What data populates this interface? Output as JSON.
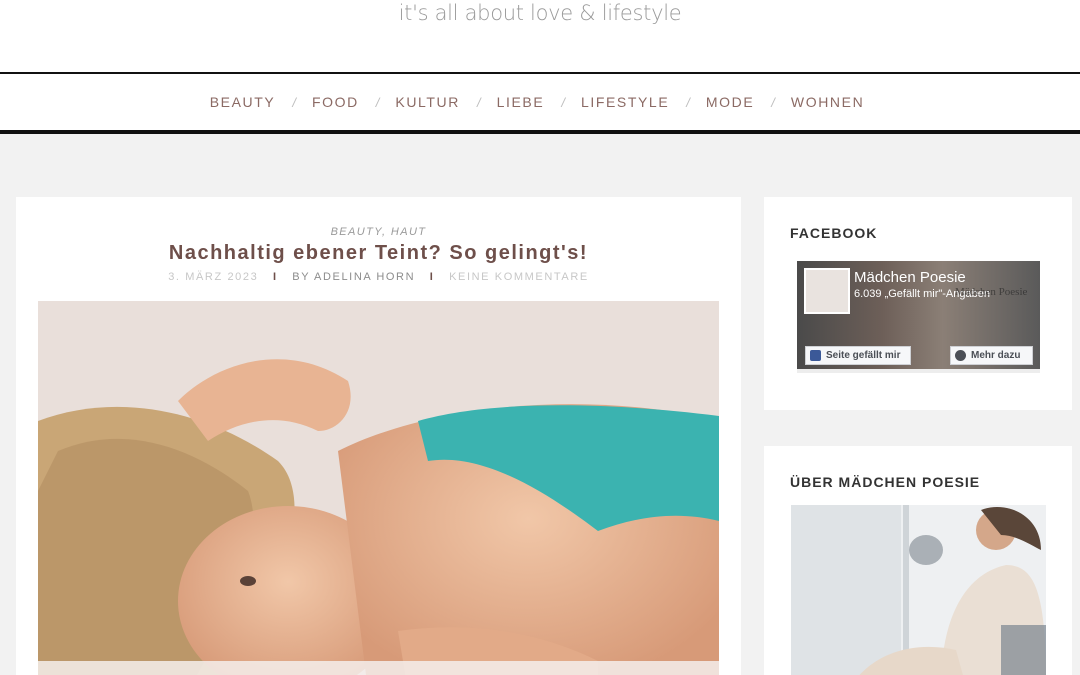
{
  "header": {
    "tagline": "it's all about love & lifestyle"
  },
  "nav": {
    "items": [
      "BEAUTY",
      "FOOD",
      "KULTUR",
      "LIEBE",
      "LIFESTYLE",
      "MODE",
      "WOHNEN"
    ],
    "separator": "/"
  },
  "post": {
    "categories": "BEAUTY, HAUT",
    "title": "Nachhaltig ebener Teint? So gelingt's!",
    "date": "3. MÄRZ 2023",
    "author": "BY ADELINA HORN",
    "comments": "KEINE KOMMENTARE",
    "meta_separator": "I"
  },
  "sidebar": {
    "facebook": {
      "title": "FACEBOOK",
      "page_name": "Mädchen Poesie",
      "likes": "6.039 „Gefällt mir\"-Angaben",
      "like_button": "Seite gefällt mir",
      "more_button": "Mehr dazu",
      "cover_text": "Mädchen Poesie"
    },
    "about": {
      "title": "ÜBER MÄDCHEN POESIE"
    }
  },
  "colors": {
    "accent": "#8b6a64",
    "title": "#6e4f4a",
    "background": "#f2f2f2"
  }
}
